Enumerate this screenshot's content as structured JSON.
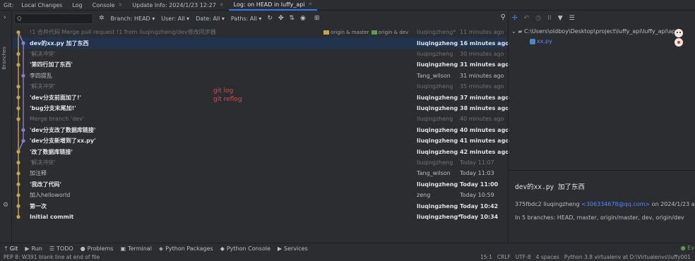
{
  "topbar": {
    "label": "Git:",
    "tabs": [
      {
        "label": "Local Changes",
        "closable": false,
        "active": false
      },
      {
        "label": "Log",
        "closable": false,
        "active": false
      },
      {
        "label": "Console",
        "closable": true,
        "active": false
      },
      {
        "label": "Update Info: 2024/1/23 12:27",
        "closable": true,
        "active": false
      },
      {
        "label": "Log: on HEAD in luffy_api",
        "closable": true,
        "active": true
      }
    ]
  },
  "gutter": {
    "label": "Branches"
  },
  "toolbar": {
    "search_placeholder": "Q",
    "branch": "Branch: HEAD ▾",
    "user": "User: All ▾",
    "date": "Date: All ▾",
    "paths": "Paths: All ▾"
  },
  "commits": [
    {
      "msg": "!1 合并代码 Merge pull request !1 from liuqingzheng/dev修改同步器",
      "author": "liuqingzheng*",
      "date": "11 minutes ago",
      "style": "dim",
      "selected": false,
      "refs": [
        "origin & master",
        "origin & dev"
      ]
    },
    {
      "msg": "dev的xx.py 加了东西",
      "author": "liuqingzheng",
      "date": "16 minutes ago",
      "style": "bold",
      "selected": true,
      "refs": []
    },
    {
      "msg": "'解决冲突'",
      "author": "liuqingzheng",
      "date": "30 minutes ago",
      "style": "dim",
      "selected": false,
      "refs": []
    },
    {
      "msg": "'第四行加了东西'",
      "author": "liuqingzheng",
      "date": "31 minutes ago",
      "style": "bold",
      "selected": false,
      "refs": []
    },
    {
      "msg": "李四提乱",
      "author": "Tang_wilson",
      "date": "31 minutes ago",
      "style": "norm",
      "selected": false,
      "refs": []
    },
    {
      "msg": "'解决冲突'",
      "author": "liuqingzheng",
      "date": "35 minutes ago",
      "style": "dim",
      "selected": false,
      "refs": []
    },
    {
      "msg": "'dev分支前面加了!'",
      "author": "liuqingzheng",
      "date": "37 minutes ago",
      "style": "bold",
      "selected": false,
      "refs": []
    },
    {
      "msg": "'bug分支末尾加!'",
      "author": "liuqingzheng",
      "date": "38 minutes ago",
      "style": "bold",
      "selected": false,
      "refs": []
    },
    {
      "msg": "Merge branch 'dev'",
      "author": "liuqingzheng",
      "date": "40 minutes ago",
      "style": "dim",
      "selected": false,
      "refs": []
    },
    {
      "msg": "'dev分支改了数据库链接'",
      "author": "liuqingzheng",
      "date": "40 minutes ago",
      "style": "bold",
      "selected": false,
      "refs": []
    },
    {
      "msg": "'dev分支新增到了xx.py'",
      "author": "liuqingzheng",
      "date": "41 minutes ago",
      "style": "bold",
      "selected": false,
      "refs": []
    },
    {
      "msg": "'改了数据库链接'",
      "author": "liuqingzheng",
      "date": "42 minutes ago",
      "style": "bold",
      "selected": false,
      "refs": []
    },
    {
      "msg": "'解决冲突'",
      "author": "liuqingzheng",
      "date": "Today 11:07",
      "style": "dim",
      "selected": false,
      "refs": []
    },
    {
      "msg": "加注释",
      "author": "Tang_wilson",
      "date": "Today 11:03",
      "style": "norm",
      "selected": false,
      "refs": []
    },
    {
      "msg": "'我改了代码'",
      "author": "liuqingzheng",
      "date": "Today 11:00",
      "style": "bold",
      "selected": false,
      "refs": []
    },
    {
      "msg": "加入helloworld",
      "author": "zeng",
      "date": "Today 10:59",
      "style": "norm",
      "selected": false,
      "refs": []
    },
    {
      "msg": "第一次",
      "author": "liuqingzheng",
      "date": "Today 10:42",
      "style": "bold",
      "selected": false,
      "refs": []
    },
    {
      "msg": "Initial commit",
      "author": "liuqingzheng*",
      "date": "Today 10:34",
      "style": "bold",
      "selected": false,
      "refs": []
    }
  ],
  "annotations": [
    "git log",
    "git reflog"
  ],
  "details": {
    "path": "C:\\Users\\oldboy\\Desktop\\project\\luffy_api\\luffy_api\\ap",
    "file": "xx.py",
    "commit_title": "dev的xx.py 加了东西",
    "hash_author": "375fbdc2 liuqingzheng ",
    "email": "<306334678@qq.com>",
    "on_date": " on 2024/1/23 at 12:13",
    "branches": "In 5 branches: HEAD, master, origin/master, dev, origin/dev"
  },
  "bottombar": {
    "items": [
      {
        "label": "Git",
        "icon": "git-icon",
        "glyph": "ᛘ",
        "active": true
      },
      {
        "label": "Run",
        "icon": "run-icon",
        "glyph": "▶",
        "active": false
      },
      {
        "label": "TODO",
        "icon": "todo-icon",
        "glyph": "☰",
        "active": false
      },
      {
        "label": "Problems",
        "icon": "problems-icon",
        "glyph": "●",
        "active": false
      },
      {
        "label": "Terminal",
        "icon": "terminal-icon",
        "glyph": "▣",
        "active": false
      },
      {
        "label": "Python Packages",
        "icon": "packages-icon",
        "glyph": "◈",
        "active": false
      },
      {
        "label": "Python Console",
        "icon": "python-console-icon",
        "glyph": "◆",
        "active": false
      },
      {
        "label": "Services",
        "icon": "services-icon",
        "glyph": "▶",
        "active": false
      }
    ],
    "right": "Ev"
  },
  "statusbar": {
    "message": "PEP 8: W391 blank line at end of file",
    "position": "15:1",
    "line_sep": "CRLF",
    "encoding": "UTF-8",
    "indent": "4 spaces",
    "interpreter": "Python 3.8 virtualenv at D:\\Virtualenvs\\luffy001"
  },
  "colors": {
    "accent": "#3574f0",
    "selected_row": "#22344d",
    "graph_yellow": "#c8a545",
    "graph_purple": "#8a7fc7",
    "annotation_red": "#e0484a",
    "link_blue": "#548af7"
  }
}
